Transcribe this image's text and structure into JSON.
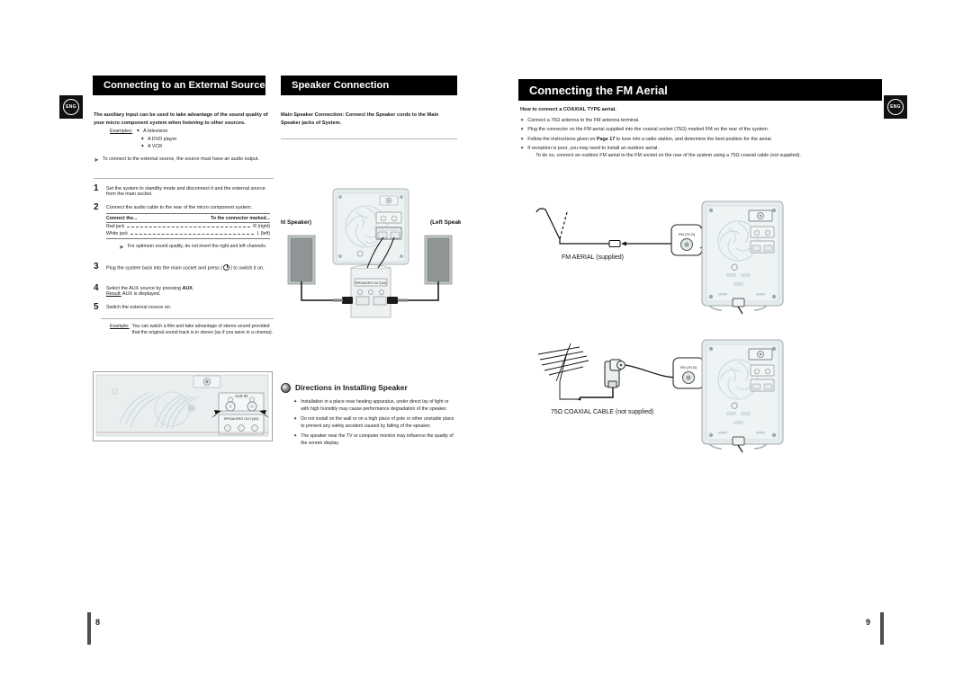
{
  "document": {
    "language_badge": "ENG"
  },
  "left_page": {
    "page_number": "8",
    "sections": {
      "aux": {
        "header": "Connecting to an External Source",
        "intro": "The auxiliary input can be used to take advantage of the sound quality of your micro component system when listening to other sources.",
        "examples_label": "Examples:",
        "examples": [
          "A television",
          "A DVD player",
          "A VCR"
        ],
        "note": "To connect to  the external source, the source must have an audio output.",
        "steps": [
          {
            "num": "1",
            "text": "Set the system to standby mode and disconnect it and the external source from the main socket."
          },
          {
            "num": "2",
            "text": "Connect the audio cable to the rear of the micro component system."
          },
          {
            "num": "3",
            "text": "Plug the system back into the main socket and press (   ) to switch it on."
          },
          {
            "num": "4",
            "text": "Select the AUX source by pressing AUX."
          },
          {
            "num": "5",
            "text": "Switch the external source on."
          }
        ],
        "step3_prefix": "Plug the system back into the main socket and press (",
        "step3_suffix": ") to switch it on.",
        "step4_text": "Select the AUX source by pressing ",
        "step4_bold": "AUX",
        "step4_period": ".",
        "step4_result_label": "Result:",
        "step4_result": " AUX is displayed.",
        "jack_table": {
          "header_left": "Connect the...",
          "header_right": "To the connector marked...",
          "rows": [
            {
              "left": "Red jack",
              "right": "R (right)"
            },
            {
              "left": "White jack",
              "right": "L (left)"
            }
          ]
        },
        "table_note": "For optimum sound quality, do not invert the right and left channels.",
        "example_label": "Example:",
        "example_text": "You can watch a film and take advantage of stereo sound provided that the original sound track is in stereo (as if you were in a cinema)."
      },
      "speaker": {
        "header": "Speaker Connection",
        "intro": "Main Speaker Connection: Connect the Speaker cords to the Main Speaker jacks of System.",
        "directions_title": "Directions in Installing Speaker",
        "directions": [
          "Installation in a place near heating apparatus, under direct lay of light or with high humidity may cause performance degradation of the speaker.",
          "Do not install on the wall or on a high place of pole or other unstable place to prevent any safety accident caused by falling of the speaker.",
          " The speaker near the TV or computer monitor may influence the quality of the screen display."
        ]
      }
    },
    "diagrams": {
      "aux_rear_panel": {
        "aux_in_label": "AUX IN",
        "speakers_out_label": "SPEAKERS  OUT(4Ω)"
      },
      "speakers": {
        "right_label": "(Right Speaker)",
        "left_label": "(Left Speaker)",
        "jack_panel_label": "SPEAKERS  OUT(4Ω)"
      }
    }
  },
  "right_page": {
    "page_number": "9",
    "sections": {
      "fm": {
        "header": "Connecting the FM Aerial",
        "howto": "How to connect a COAXIAL TYPE aerial.",
        "bullets": [
          {
            "text": "Connect a 75Ω antenna to the FM antenna terminal."
          },
          {
            "text": "Plug the connector on the FM aerial supplied into the coaxial socket (75Ω) marked FM on the rear of the system."
          },
          {
            "pre": "Follow the instructions given on ",
            "bold": "Page 17",
            "post": " to tune into a radio station, and determine the best position for the aerial."
          },
          {
            "text": "If reception is poor, you may need to install an outdoor aerial.",
            "sub": "To do so, connect an outdoor FM aerial to the FM socket on the rear of the system using a 75Ω coaxial cable (not supplied)."
          }
        ]
      }
    },
    "diagrams": {
      "fm_supplied": {
        "caption": "FM AERIAL (supplied)",
        "socket_callout": "FM (75 Ω)"
      },
      "fm_coaxial": {
        "caption": "75Ω COAXIAL CABLE (not supplied)",
        "socket_callout": "FM (75 Ω)"
      }
    }
  },
  "colors": {
    "header_bar": "#000000",
    "header_text": "#ffffff",
    "rule": "#b5b5b5",
    "page_bar": "#4f4f4f",
    "speaker_body": "#8f8f8f",
    "chassis": "#d7dbdc"
  }
}
